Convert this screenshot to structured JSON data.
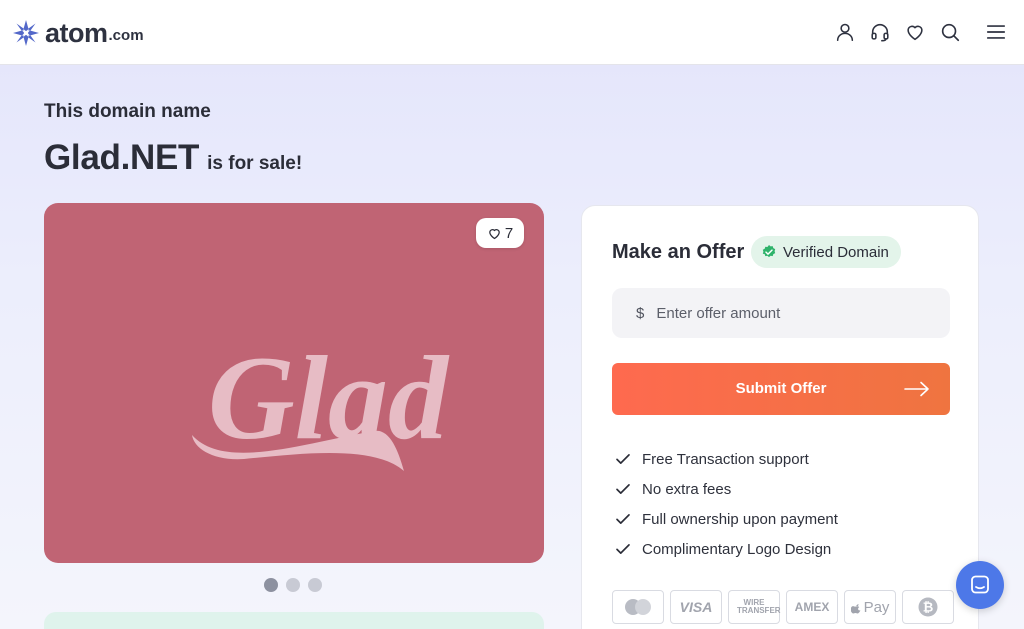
{
  "header": {
    "logo_text": "atom",
    "logo_tld": ".com",
    "icons": [
      "user-icon",
      "headset-icon",
      "heart-icon",
      "search-icon",
      "menu-icon"
    ]
  },
  "hero": {
    "kicker": "This domain name",
    "domain": "Glad.NET",
    "suffix": "is for sale!"
  },
  "logo_card": {
    "logo_text": "Glad",
    "likes": "7",
    "background": "#c06474",
    "slide_dots": 3,
    "active_slide": 1
  },
  "offer": {
    "title": "Make an Offer",
    "verified_label": "Verified Domain",
    "currency_symbol": "$",
    "amount_placeholder": "Enter offer amount",
    "submit_label": "Submit Offer",
    "features": [
      "Free Transaction support",
      "No extra fees",
      "Full ownership upon payment",
      "Complimentary Logo Design"
    ],
    "payments": [
      "mastercard-icon",
      "VISA",
      "WIRE TRANSFER",
      "AMEX",
      "Pay",
      "bitcoin-icon"
    ]
  },
  "colors": {
    "accent_orange": "#fe6a4f",
    "verified_green": "#2fb36b",
    "brand_blue": "#4d78e8",
    "text_dark": "#2b2d38"
  }
}
